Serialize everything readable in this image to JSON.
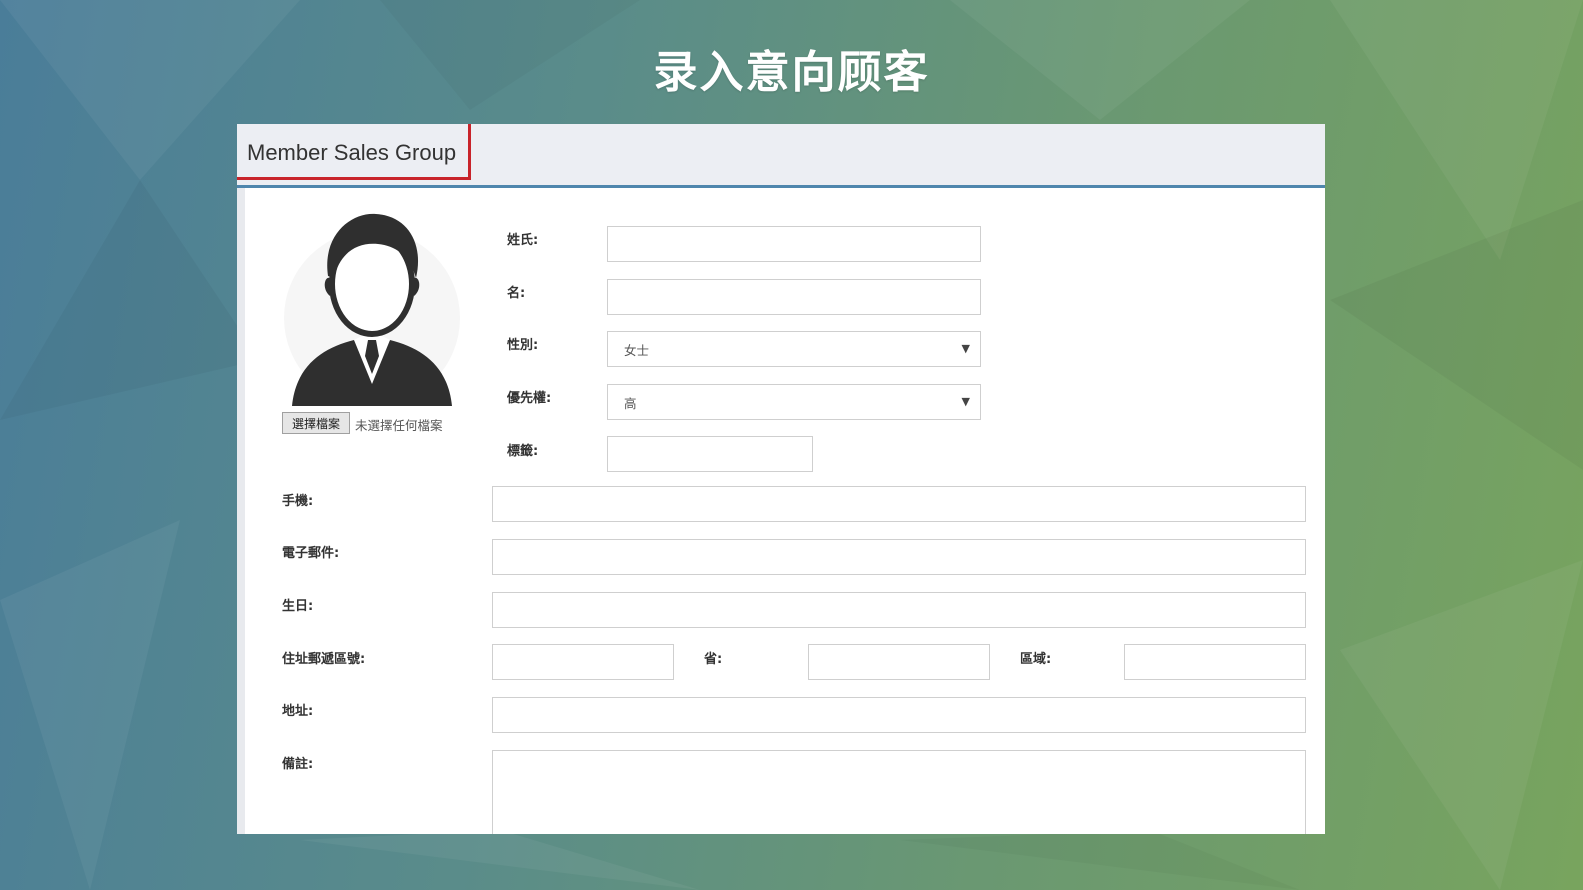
{
  "slide": {
    "title": "录入意向顾客"
  },
  "app": {
    "brand": "Member Sales Group"
  },
  "avatar": {
    "icon": "person-avatar-icon"
  },
  "upload": {
    "button_label": "選擇檔案",
    "status": "未選擇任何檔案"
  },
  "form": {
    "last_name": {
      "label": "姓氏:",
      "value": ""
    },
    "first_name": {
      "label": "名:",
      "value": ""
    },
    "gender": {
      "label": "性別:",
      "value": "女士"
    },
    "priority": {
      "label": "優先權:",
      "value": "高"
    },
    "tag": {
      "label": "標籤:",
      "value": ""
    },
    "mobile": {
      "label": "手機:",
      "value": ""
    },
    "email": {
      "label": "電子郵件:",
      "value": ""
    },
    "birthday": {
      "label": "生日:",
      "value": ""
    },
    "postal_code": {
      "label": "住址郵遞區號:",
      "value": ""
    },
    "province": {
      "label": "省:",
      "value": ""
    },
    "district": {
      "label": "區域:",
      "value": ""
    },
    "address": {
      "label": "地址:",
      "value": ""
    },
    "remarks": {
      "label": "備註:",
      "value": ""
    }
  },
  "colors": {
    "accent_bar": "#4f86ad",
    "highlight_box": "#c8232a"
  }
}
